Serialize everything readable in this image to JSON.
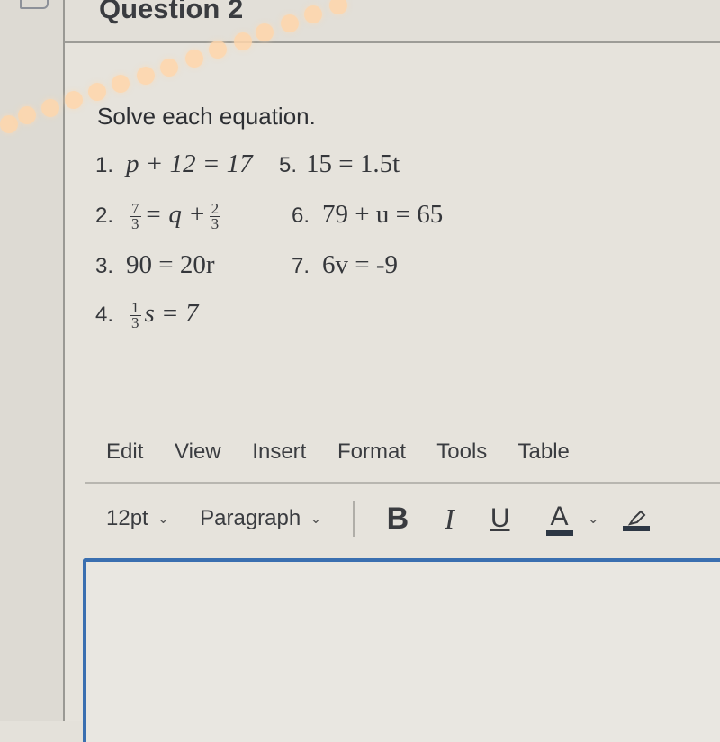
{
  "question": {
    "title": "Question 2"
  },
  "prompt": "Solve each equation.",
  "equations": [
    {
      "number": "1.",
      "text": "p + 12 = 17"
    },
    {
      "number": "5.",
      "text": "15 = 1.5t"
    },
    {
      "number": "2.",
      "lhs_frac": {
        "n": "7",
        "d": "3"
      },
      "mid": "= q +",
      "rhs_frac": {
        "n": "2",
        "d": "3"
      }
    },
    {
      "number": "6.",
      "text": "79 + u = 65"
    },
    {
      "number": "3.",
      "text": "90 = 20r"
    },
    {
      "number": "7.",
      "text": "6v = -9"
    },
    {
      "number": "4.",
      "lhs_frac": {
        "n": "1",
        "d": "3"
      },
      "rest": "s = 7"
    }
  ],
  "editor": {
    "menu": [
      "Edit",
      "View",
      "Insert",
      "Format",
      "Tools",
      "Table"
    ],
    "font_size": "12pt",
    "block_format": "Paragraph",
    "buttons": {
      "bold": "B",
      "italic": "I",
      "underline": "U",
      "text_color": "A"
    },
    "chevron": "⌄",
    "accent_color": "#3a6fb0",
    "body": ""
  }
}
